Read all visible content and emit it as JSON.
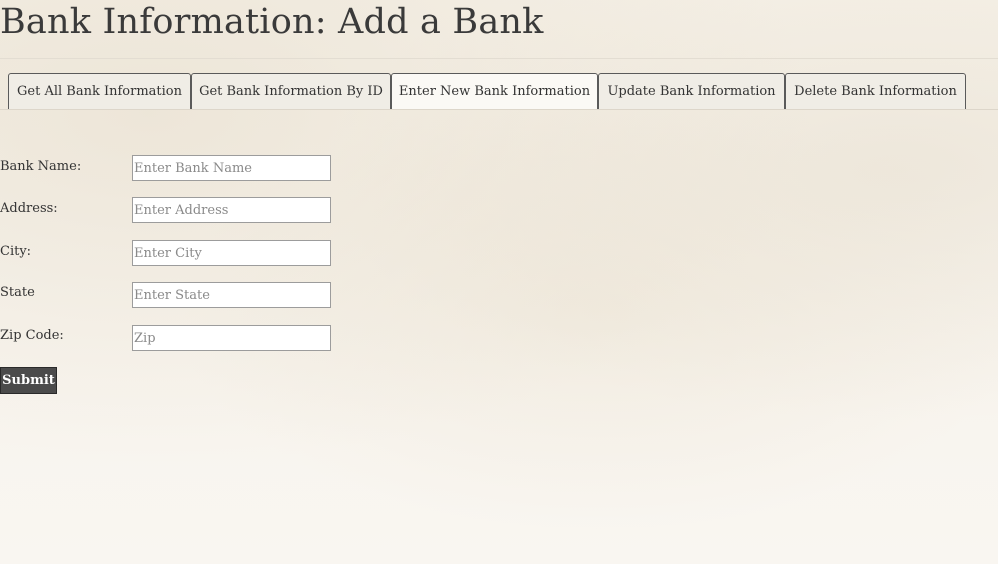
{
  "page": {
    "title": "Bank Information: Add a Bank"
  },
  "tabs": [
    {
      "label": "Get All Bank Information"
    },
    {
      "label": "Get Bank Information By ID"
    },
    {
      "label": "Enter New Bank Information",
      "active": true
    },
    {
      "label": "Update Bank Information"
    },
    {
      "label": "Delete Bank Information"
    }
  ],
  "form": {
    "fields": [
      {
        "label": "Bank Name:",
        "placeholder": "Enter Bank Name",
        "value": ""
      },
      {
        "label": "Address:",
        "placeholder": "Enter Address",
        "value": ""
      },
      {
        "label": "City:",
        "placeholder": "Enter City",
        "value": ""
      },
      {
        "label": "State",
        "placeholder": "Enter State",
        "value": ""
      },
      {
        "label": "Zip Code:",
        "placeholder": "Zip",
        "value": ""
      }
    ],
    "submit_label": "Submit"
  },
  "colors": {
    "background": "#f7f3ec",
    "submit_background": "#4b4b4b",
    "submit_text": "#ffffff",
    "text": "#333333"
  }
}
